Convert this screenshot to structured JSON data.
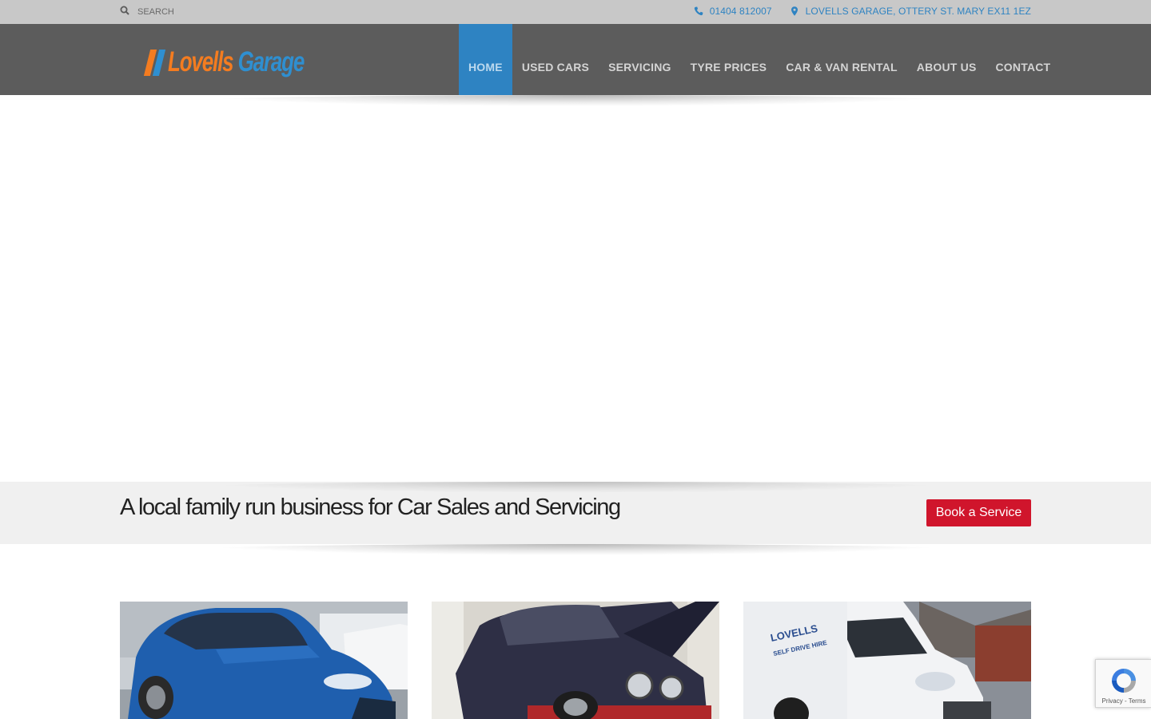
{
  "topbar": {
    "search_placeholder": "SEARCH",
    "search_icon": "search-icon",
    "phone_icon": "phone-icon",
    "phone": "01404 812007",
    "location_icon": "map-marker-icon",
    "address": "LOVELLS GARAGE, OTTERY ST. MARY EX11 1EZ"
  },
  "header": {
    "logo": {
      "part1": "Lovells",
      "part2": "Garage"
    },
    "nav": [
      {
        "label": "HOME",
        "active": true
      },
      {
        "label": "USED CARS"
      },
      {
        "label": "SERVICING"
      },
      {
        "label": "TYRE PRICES"
      },
      {
        "label": "CAR & VAN RENTAL"
      },
      {
        "label": "ABOUT US"
      },
      {
        "label": "CONTACT"
      }
    ]
  },
  "banner": {
    "tagline": "A local family run business for Car Sales and Servicing",
    "cta_label": "Book a Service"
  },
  "cards": [
    {
      "image": "blue-hatchback-photo"
    },
    {
      "image": "car-on-service-ramp-photo"
    },
    {
      "image": "white-self-drive-hire-van-photo",
      "van_text_1": "LOVELLS",
      "van_text_2": "SELF DRIVE HIRE"
    }
  ],
  "recaptcha": {
    "links": "Privacy - Terms"
  },
  "colors": {
    "topbar": "#c8c8c8",
    "header": "#5c5c5c",
    "accent_blue": "#2e83c2",
    "logo_orange": "#f47c20",
    "cta_red": "#d0152c",
    "band": "#f0f0f0"
  }
}
